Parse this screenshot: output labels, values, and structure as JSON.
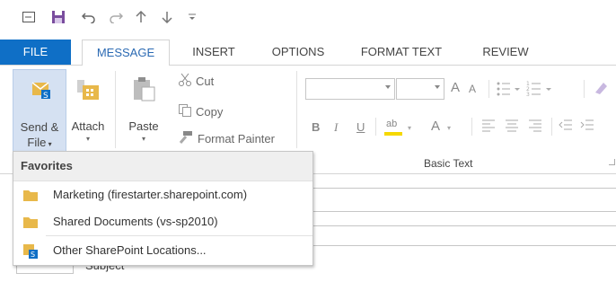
{
  "ribbon_tabs": [
    {
      "label": "FILE"
    },
    {
      "label": "MESSAGE"
    },
    {
      "label": "INSERT"
    },
    {
      "label": "OPTIONS"
    },
    {
      "label": "FORMAT TEXT"
    },
    {
      "label": "REVIEW"
    }
  ],
  "clipboard": {
    "send_file_line1": "Send &",
    "send_file_line2": "File",
    "attach": "Attach",
    "paste": "Paste",
    "cut": "Cut",
    "copy": "Copy",
    "format_painter": "Format Painter"
  },
  "basic_text": {
    "group_label": "Basic Text",
    "bold": "B",
    "italic": "I",
    "underline": "U",
    "grow_font": "A",
    "shrink_font": "A",
    "font_color": "A",
    "highlight": "ab"
  },
  "menu": {
    "header": "Favorites",
    "items": [
      {
        "label": "Marketing (firestarter.sharepoint.com)",
        "icon": "folder-icon"
      },
      {
        "label": "Shared Documents (vs-sp2010)",
        "icon": "folder-icon"
      },
      {
        "label": "Other SharePoint Locations...",
        "icon": "sharepoint-icon"
      }
    ]
  },
  "compose": {
    "subject_label": "Subject"
  },
  "colors": {
    "file_tab": "#0f6fc6",
    "accent_text": "#2b6ab3",
    "folder": "#e8b84a"
  }
}
